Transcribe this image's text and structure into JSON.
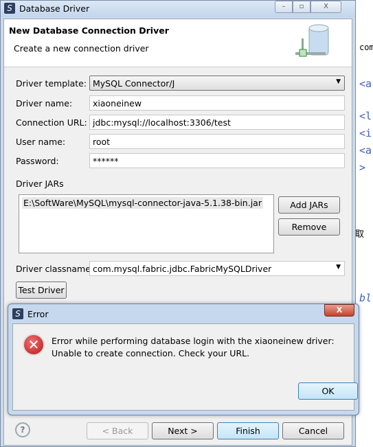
{
  "background": {
    "fragments": [
      "com",
      "<a",
      "<l",
      "<i",
      "<a",
      ">",
      "取",
      "bl"
    ]
  },
  "window": {
    "title": "Database Driver",
    "controls": [
      "minimize",
      "maximize",
      "close"
    ]
  },
  "header": {
    "title": "New Database Connection Driver",
    "subtitle": "Create a new connection driver",
    "icon": "database-icon"
  },
  "form": {
    "driver_template": {
      "label": "Driver template:",
      "value": "MySQL Connector/J"
    },
    "driver_name": {
      "label": "Driver name:",
      "value": "xiaoneinew"
    },
    "connection_url": {
      "label": "Connection URL:",
      "value": "jdbc:mysql://localhost:3306/test"
    },
    "user_name": {
      "label": "User name:",
      "value": "root"
    },
    "password": {
      "label": "Password:",
      "value": "******"
    },
    "jars_label": "Driver JARs",
    "jars": [
      "E:\\SoftWare\\MySQL\\mysql-connector-java-5.1.38-bin.jar"
    ],
    "add_jars": "Add JARs",
    "remove": "Remove",
    "classname": {
      "label": "Driver classname:",
      "value": "com.mysql.fabric.jdbc.FabricMySQLDriver"
    },
    "test_driver": "Test Driver"
  },
  "footer": {
    "back": "< Back",
    "next": "Next >",
    "finish": "Finish",
    "cancel": "Cancel"
  },
  "error_dialog": {
    "title": "Error",
    "line1": "Error while performing database login with the xiaoneinew driver:",
    "line2": "Unable to create connection. Check your URL.",
    "ok": "OK",
    "icon": "error-icon",
    "close": "X"
  }
}
